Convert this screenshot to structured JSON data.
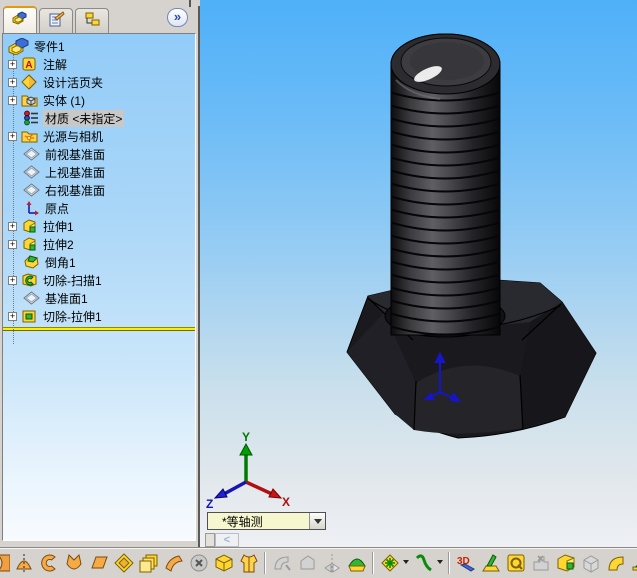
{
  "left_panel": {
    "tabs": [
      {
        "name": "featuremanager-tab"
      },
      {
        "name": "propertymanager-tab"
      },
      {
        "name": "configurationmanager-tab"
      }
    ],
    "chevron_label": "»",
    "tree": {
      "root_label": "零件1",
      "plus_glyph": "+",
      "items": [
        {
          "label": "注解",
          "expandable": true,
          "icon": "annotations-icon"
        },
        {
          "label": "设计活页夹",
          "expandable": true,
          "icon": "design-binder-icon"
        },
        {
          "label": "实体 (1)",
          "expandable": true,
          "icon": "solid-bodies-folder-icon"
        },
        {
          "label": "材质 <未指定>",
          "expandable": false,
          "icon": "material-icon",
          "highlighted": true
        },
        {
          "label": "光源与相机",
          "expandable": true,
          "icon": "lights-cameras-folder-icon"
        },
        {
          "label": "前视基准面",
          "expandable": false,
          "icon": "plane-icon"
        },
        {
          "label": "上视基准面",
          "expandable": false,
          "icon": "plane-icon"
        },
        {
          "label": "右视基准面",
          "expandable": false,
          "icon": "plane-icon"
        },
        {
          "label": "原点",
          "expandable": false,
          "icon": "origin-icon"
        },
        {
          "label": "拉伸1",
          "expandable": true,
          "icon": "extrude-icon"
        },
        {
          "label": "拉伸2",
          "expandable": true,
          "icon": "extrude-icon"
        },
        {
          "label": "倒角1",
          "expandable": false,
          "icon": "chamfer-icon"
        },
        {
          "label": "切除-扫描1",
          "expandable": true,
          "icon": "cut-sweep-icon"
        },
        {
          "label": "基准面1",
          "expandable": false,
          "icon": "plane-icon"
        },
        {
          "label": "切除-拉伸1",
          "expandable": true,
          "icon": "cut-extrude-icon"
        }
      ]
    }
  },
  "viewport": {
    "view_selector_value": "*等轴测",
    "scroll_left_glyph": "<",
    "triad": {
      "x": "X",
      "y": "Y",
      "z": "Z",
      "x_color": "#cc0000",
      "y_color": "#008000",
      "z_color": "#0000bb"
    },
    "model": "hex-bolt-dark-gray"
  },
  "toolbar": {
    "icons": [
      "partial-edge-icon",
      "revolve-boss-icon",
      "sweep-icon",
      "loft-icon",
      "boundary-boss-icon",
      "extruded-surface-icon",
      "linear-pattern-icon",
      "flex-icon",
      "sphere-disabled-icon",
      "wrap-icon",
      "rib-vest-icon",
      "fillet-disabled-icon",
      "chamfer-disabled-icon",
      "mirror-disabled-icon",
      "dome-icon",
      "reference-point-icon",
      "curve-icon",
      "3d-sketch-icon",
      "sketch-driven-icon",
      "derived-part-icon",
      "disabled-feature-icon",
      "extrude-boss-icon",
      "shell-disabled-icon",
      "fillet-icon",
      "draft-icon",
      "rib-icon"
    ]
  }
}
